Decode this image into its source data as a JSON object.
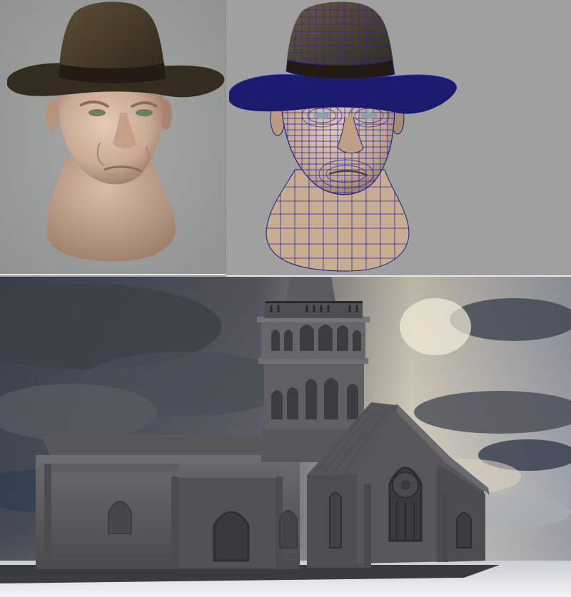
{
  "scene": {
    "panels": [
      {
        "id": "shaded-head-render",
        "subject": "head-with-fedora",
        "style": "shaded"
      },
      {
        "id": "wireframe-head-render",
        "subject": "head-with-fedora",
        "style": "wireframe"
      },
      {
        "id": "church-render",
        "subject": "church-with-tower",
        "style": "grey-untextured"
      }
    ]
  },
  "colors": {
    "background": "#a0a2a3",
    "skin": "#c9a992",
    "hat": "#3e3426",
    "hat_band": "#241c14",
    "wire": "#1c1c8e",
    "church": "#5a5a5c",
    "sky_dark": "#3f434d",
    "sky_light": "#f1e7d2",
    "ground": "#e9ecef"
  }
}
